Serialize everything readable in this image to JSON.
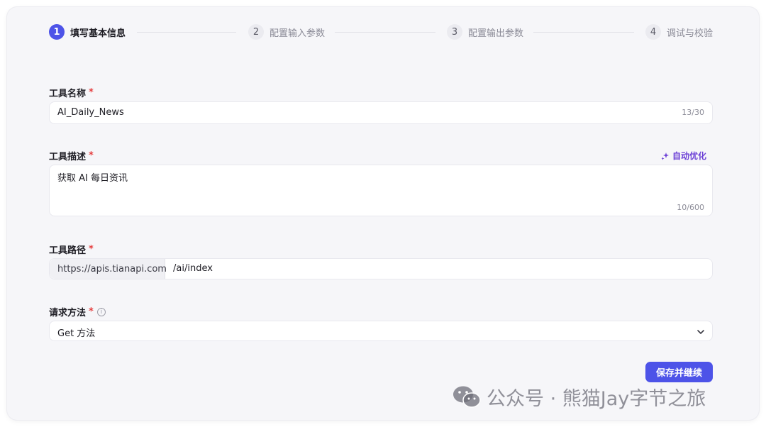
{
  "stepper": {
    "steps": [
      {
        "number": "1",
        "label": "填写基本信息",
        "active": true
      },
      {
        "number": "2",
        "label": "配置输入参数",
        "active": false
      },
      {
        "number": "3",
        "label": "配置输出参数",
        "active": false
      },
      {
        "number": "4",
        "label": "调试与校验",
        "active": false
      }
    ]
  },
  "form": {
    "tool_name": {
      "label": "工具名称",
      "required_mark": "*",
      "value": "AI_Daily_News",
      "counter": "13/30"
    },
    "tool_description": {
      "label": "工具描述",
      "required_mark": "*",
      "value": "获取 AI 每日资讯",
      "counter": "10/600",
      "auto_optimize_label": "自动优化"
    },
    "tool_path": {
      "label": "工具路径",
      "required_mark": "*",
      "prefix": "https://apis.tianapi.com",
      "value": "/ai/index"
    },
    "request_method": {
      "label": "请求方法",
      "required_mark": "*",
      "info_glyph": "i",
      "selected": "Get 方法"
    }
  },
  "actions": {
    "save_continue_label": "保存并继续"
  },
  "watermark": {
    "text": "公众号 · 熊猫Jay字节之旅"
  },
  "colors": {
    "accent": "#4d53e8",
    "required": "#e53e3e",
    "auto_optimize": "#6b3fd6"
  }
}
